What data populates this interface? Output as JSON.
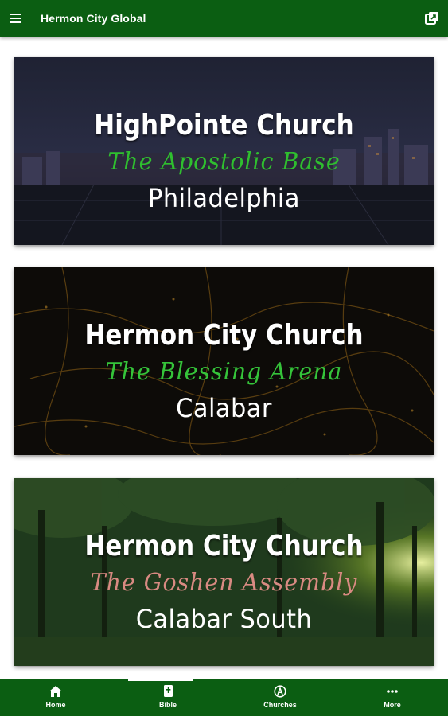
{
  "app_bar": {
    "title": "Hermon City Global",
    "menu_icon": "hamburger-menu-icon",
    "share_icon": "share-icon"
  },
  "cards": [
    {
      "title": "HighPointe Church",
      "subtitle": "The Apostolic Base",
      "city": "Philadelphia",
      "subtitle_color": "#2fbf2f",
      "background": "night city skyline"
    },
    {
      "title": "Hermon City Church",
      "subtitle": "The Blessing Arena",
      "city": "Calabar",
      "subtitle_color": "#35c43a",
      "background": "aerial city lights at night"
    },
    {
      "title": "Hermon City Church",
      "subtitle": "The Goshen Assembly",
      "city": "Calabar South",
      "subtitle_color": "#d98a82",
      "background": "green forest with sunlight"
    }
  ],
  "bottom_nav": {
    "active_index": 1,
    "items": [
      {
        "label": "Home",
        "icon": "home-icon"
      },
      {
        "label": "Bible",
        "icon": "bible-icon"
      },
      {
        "label": "Churches",
        "icon": "churches-icon"
      },
      {
        "label": "More",
        "icon": "more-icon"
      }
    ]
  },
  "colors": {
    "primary": "#0b5e12",
    "on_primary": "#ffffff"
  }
}
